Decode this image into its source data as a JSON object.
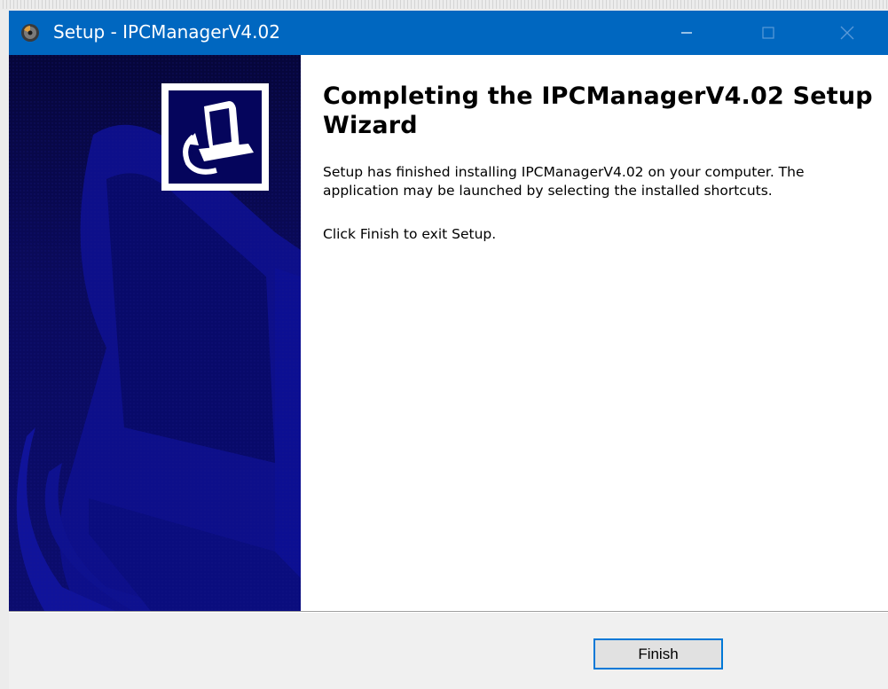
{
  "window": {
    "title": "Setup - IPCManagerV4.02",
    "app_icon": "setup-disc-icon",
    "controls": [
      "minimize-icon",
      "maximize-icon",
      "close-icon"
    ]
  },
  "wizard": {
    "banner_icon": "computer-install-icon",
    "heading": "Completing the IPCManagerV4.02 Setup Wizard",
    "message": "Setup has finished installing IPCManagerV4.02 on your computer. The application may be launched by selecting the installed shortcuts.",
    "instruction": "Click Finish to exit Setup."
  },
  "footer": {
    "finish_label": "Finish"
  },
  "colors": {
    "titlebar": "#0067c0",
    "banner": "#0a0a5c",
    "focus_border": "#0078d7"
  }
}
